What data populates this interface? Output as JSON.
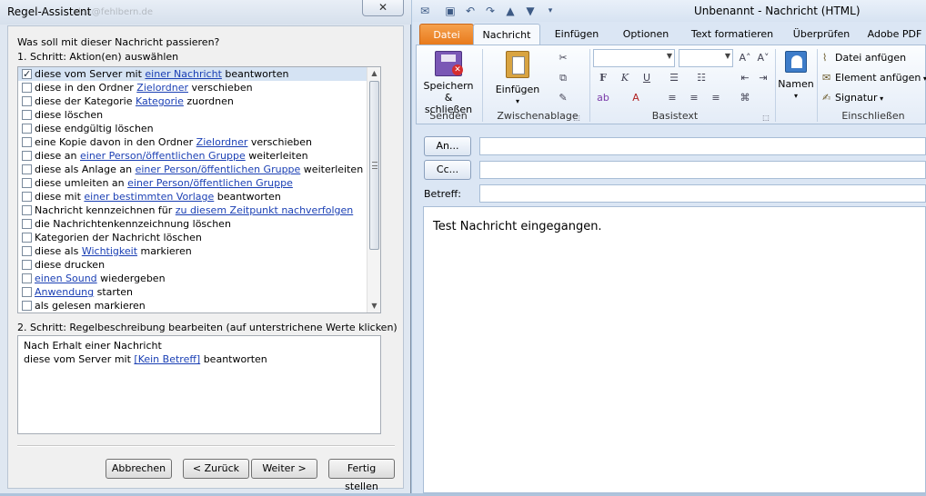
{
  "dialog": {
    "title": "Regel-Assistent",
    "close_glyph": "✕",
    "ghost_text": "alex@fehlbern.de",
    "question": "Was soll mit dieser Nachricht passieren?",
    "step1_label": "1. Schritt: Aktion(en) auswählen",
    "step2_label": "2. Schritt: Regelbeschreibung bearbeiten (auf unterstrichene Werte klicken)",
    "actions": [
      {
        "checked": true,
        "pre": "diese vom Server mit ",
        "link": "einer Nachricht",
        "post": " beantworten"
      },
      {
        "checked": false,
        "pre": "diese in den Ordner ",
        "link": "Zielordner",
        "post": " verschieben"
      },
      {
        "checked": false,
        "pre": "diese der Kategorie ",
        "link": "Kategorie",
        "post": " zuordnen"
      },
      {
        "checked": false,
        "pre": "diese löschen",
        "link": "",
        "post": ""
      },
      {
        "checked": false,
        "pre": "diese endgültig löschen",
        "link": "",
        "post": ""
      },
      {
        "checked": false,
        "pre": "eine Kopie davon in den Ordner ",
        "link": "Zielordner",
        "post": " verschieben"
      },
      {
        "checked": false,
        "pre": "diese an ",
        "link": "einer Person/öffentlichen Gruppe",
        "post": " weiterleiten"
      },
      {
        "checked": false,
        "pre": "diese als Anlage an ",
        "link": "einer Person/öffentlichen Gruppe",
        "post": " weiterleiten"
      },
      {
        "checked": false,
        "pre": "diese umleiten an ",
        "link": "einer Person/öffentlichen Gruppe",
        "post": ""
      },
      {
        "checked": false,
        "pre": "diese mit ",
        "link": "einer bestimmten Vorlage",
        "post": " beantworten"
      },
      {
        "checked": false,
        "pre": "Nachricht kennzeichnen für ",
        "link": "zu diesem Zeitpunkt nachverfolgen",
        "post": ""
      },
      {
        "checked": false,
        "pre": "die Nachrichtenkennzeichnung löschen",
        "link": "",
        "post": ""
      },
      {
        "checked": false,
        "pre": "Kategorien der Nachricht löschen",
        "link": "",
        "post": ""
      },
      {
        "checked": false,
        "pre": "diese als ",
        "link": "Wichtigkeit",
        "post": " markieren"
      },
      {
        "checked": false,
        "pre": "diese drucken",
        "link": "",
        "post": ""
      },
      {
        "checked": false,
        "pre": "",
        "link": "einen Sound",
        "post": " wiedergeben"
      },
      {
        "checked": false,
        "pre": "",
        "link": "Anwendung",
        "post": " starten"
      },
      {
        "checked": false,
        "pre": "als gelesen markieren",
        "link": "",
        "post": ""
      }
    ],
    "description": {
      "line1": "Nach Erhalt einer Nachricht",
      "line2_pre": "diese vom Server mit ",
      "line2_link": "[Kein Betreff]",
      "line2_post": " beantworten"
    },
    "buttons": {
      "cancel": "Abbrechen",
      "back": "< Zurück",
      "next": "Weiter >",
      "finish": "Fertig stellen"
    }
  },
  "outlook": {
    "title": "Unbenannt  -  Nachricht (HTML)",
    "tabs": [
      "Datei",
      "Nachricht",
      "Einfügen",
      "Optionen",
      "Text formatieren",
      "Überprüfen",
      "Adobe PDF"
    ],
    "ribbon": {
      "send_save_label": "Speichern & schließen",
      "send_save_line1": "Speichern",
      "send_save_line2": "& schließen",
      "group_send": "Senden",
      "paste_label": "Einfügen",
      "group_clipboard": "Zwischenablage",
      "group_basictext": "Basistext",
      "names_label": "Namen",
      "attach_file": "Datei anfügen",
      "attach_item": "Element anfügen",
      "signature": "Signatur",
      "group_insert": "Einschließen"
    },
    "compose": {
      "to_button": "An...",
      "cc_button": "Cc...",
      "subject_label": "Betreff:",
      "body_text": "Test Nachricht eingegangen."
    }
  }
}
